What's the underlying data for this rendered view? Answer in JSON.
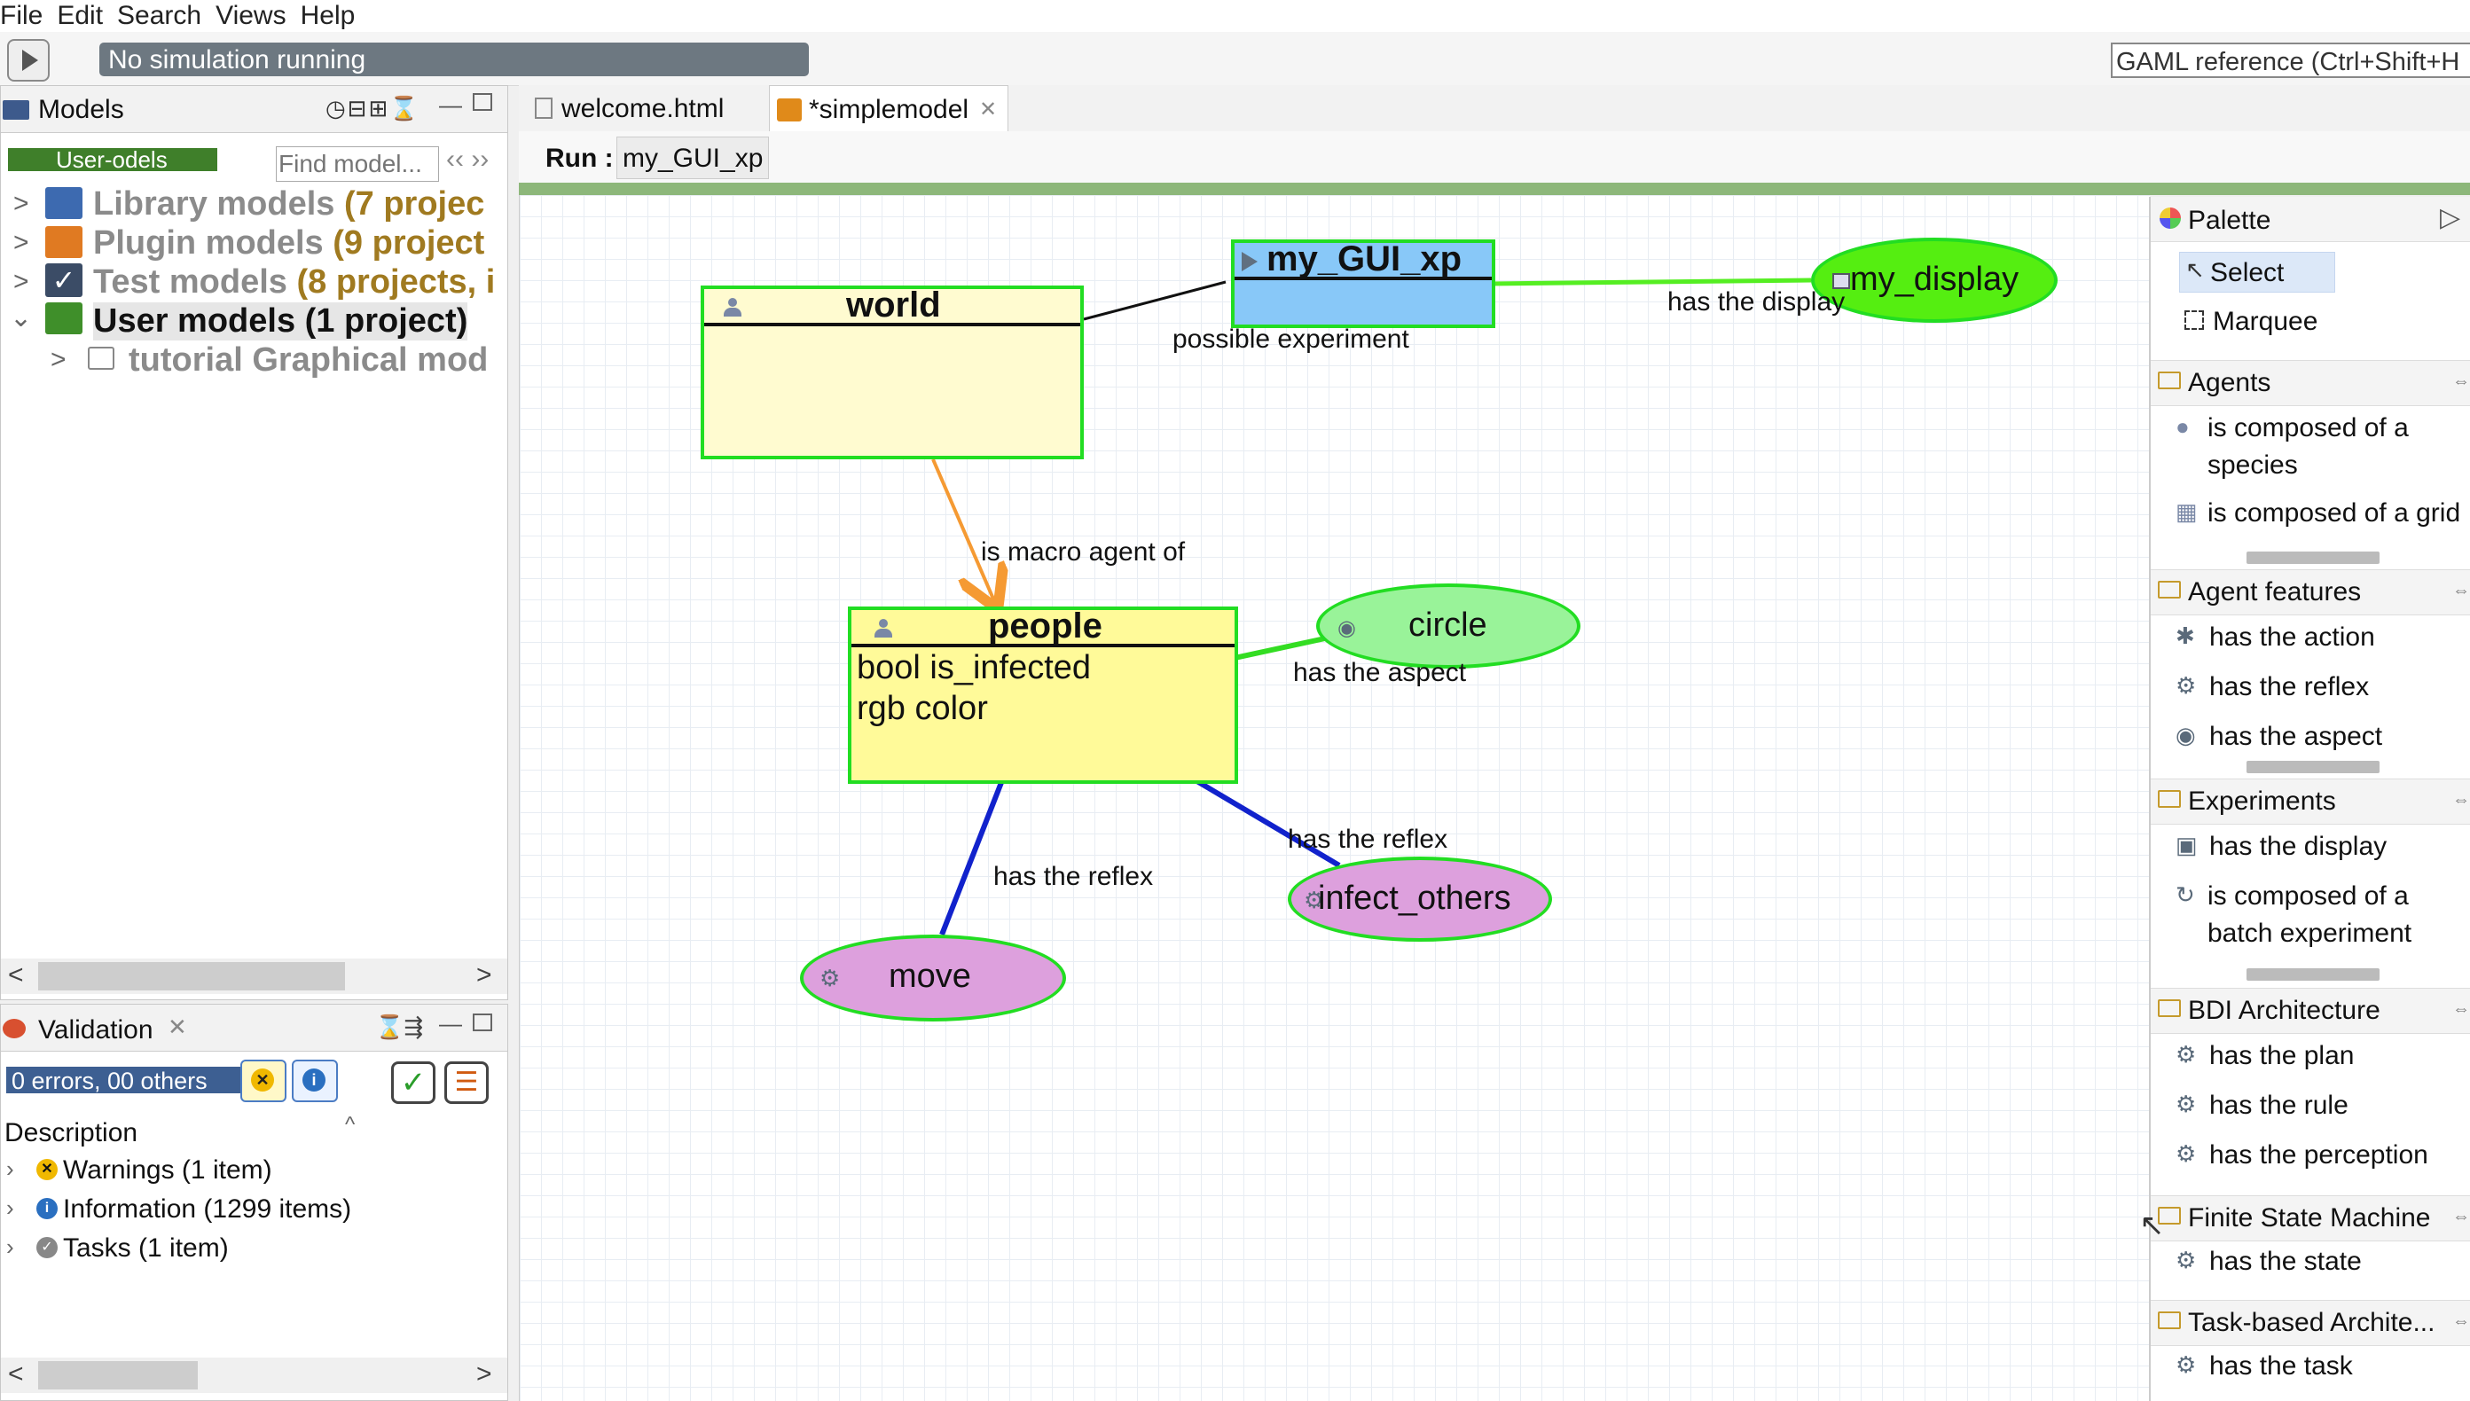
{
  "menu": {
    "file": "File",
    "edit": "Edit",
    "search": "Search",
    "views": "Views",
    "help": "Help"
  },
  "toolbar": {
    "status": "No simulation running",
    "gaml_reference": "GAML reference (Ctrl+Shift+H"
  },
  "models_panel": {
    "title": "Models",
    "user_badge": "User-odels",
    "find_placeholder": "Find model...",
    "tree": [
      {
        "label": "Library models",
        "count": "(7 projec"
      },
      {
        "label": "Plugin models",
        "count": "(9 project"
      },
      {
        "label": "Test models",
        "count": "(8 projects, i"
      },
      {
        "label": "User models (1 project)"
      },
      {
        "label": "tutorial Graphical mod"
      }
    ]
  },
  "validation_panel": {
    "title": "Validation",
    "summary": "0 errors, 00 others",
    "description_header": "Description",
    "rows": [
      {
        "label": "Warnings (1 item)"
      },
      {
        "label": "Information (1299 items)"
      },
      {
        "label": "Tasks (1 item)"
      }
    ]
  },
  "editor": {
    "tabs": [
      {
        "label": "welcome.html"
      },
      {
        "label": "*simplemodel"
      }
    ],
    "run_label": "Run :",
    "run_value": "my_GUI_xp"
  },
  "diagram": {
    "world": {
      "title": "world"
    },
    "gui_xp": {
      "title": "my_GUI_xp"
    },
    "my_display": {
      "label": "my_display"
    },
    "people": {
      "title": "people",
      "attributes": [
        "bool is_infected",
        "rgb color"
      ]
    },
    "circle": {
      "label": "circle"
    },
    "move": {
      "label": "move"
    },
    "infect_others": {
      "label": "infect_others"
    },
    "edges": {
      "possible_experiment": "possible experiment",
      "has_display": "has the display",
      "macro_agent": "is macro agent of",
      "has_aspect": "has the aspect",
      "reflex_move": "has the reflex",
      "reflex_infect": "has the reflex"
    }
  },
  "palette": {
    "title": "Palette",
    "tools": {
      "select": "Select",
      "marquee": "Marquee"
    },
    "sections": [
      {
        "title": "Agents",
        "items": [
          "is composed of a",
          "species",
          "is composed of a grid"
        ]
      },
      {
        "title": "Agent features",
        "items": [
          "has the action",
          "has the reflex",
          "has the aspect"
        ]
      },
      {
        "title": "Experiments",
        "items": [
          "has the display",
          "is composed of a",
          "batch experiment"
        ]
      },
      {
        "title": "BDI Architecture",
        "items": [
          "has the plan",
          "has the rule",
          "has the perception"
        ]
      },
      {
        "title": "Finite State Machine",
        "items": [
          "has the state"
        ]
      },
      {
        "title": "Task-based Archite...",
        "items": [
          "has the task"
        ]
      }
    ]
  },
  "colors": {
    "node_border": "#22dd22",
    "world_fill": "#fffbd0",
    "people_fill": "#fffa99",
    "gui_fill": "#88c8f8",
    "display_fill": "#55ee11",
    "circle_fill": "#99f399",
    "reflex_fill": "#dda0dd",
    "macro_arrow": "#f59a33",
    "reflex_edge": "#1122cc"
  }
}
